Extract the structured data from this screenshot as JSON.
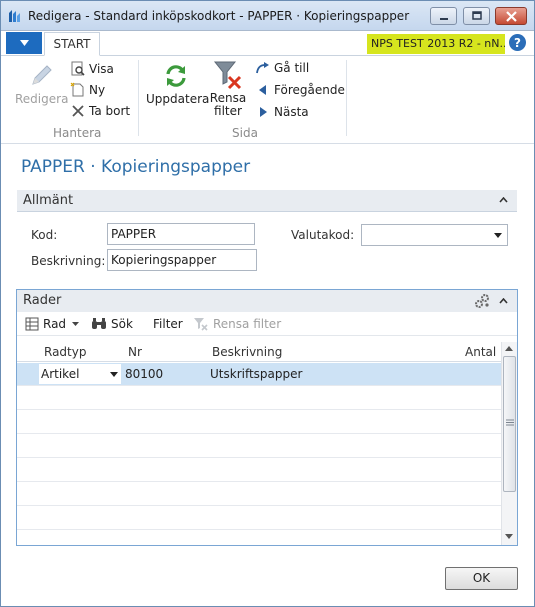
{
  "window": {
    "title": "Redigera - Standard inköpskodkort - PAPPER · Kopieringspapper"
  },
  "ribbon": {
    "tab_start": "START",
    "env_badge": "NPS TEST 2013 R2 - nN...",
    "help": "?",
    "hantera": {
      "group_label": "Hantera",
      "redigera": "Redigera",
      "visa": "Visa",
      "ny": "Ny",
      "ta_bort": "Ta bort"
    },
    "sida": {
      "group_label": "Sida",
      "uppdatera": "Uppdatera",
      "rensa_filter_1": "Rensa",
      "rensa_filter_2": "filter",
      "ga_till": "Gå till",
      "foregaende": "Föregående",
      "nasta": "Nästa"
    }
  },
  "page": {
    "title": "PAPPER · Kopieringspapper"
  },
  "general": {
    "heading": "Allmänt",
    "kod_label": "Kod:",
    "kod_value": "PAPPER",
    "beskrivning_label": "Beskrivning:",
    "beskrivning_value": "Kopieringspapper",
    "valutakod_label": "Valutakod:",
    "valutakod_value": ""
  },
  "lines": {
    "heading": "Rader",
    "toolbar": {
      "rad": "Rad",
      "sok": "Sök",
      "filter": "Filter",
      "rensa_filter": "Rensa filter"
    },
    "columns": {
      "radtyp": "Radtyp",
      "nr": "Nr",
      "beskrivning": "Beskrivning",
      "antal": "Antal"
    },
    "rows": [
      {
        "radtyp": "Artikel",
        "nr": "80100",
        "beskrivning": "Utskriftspapper",
        "antal": ""
      }
    ]
  },
  "footer": {
    "ok": "OK"
  },
  "colors": {
    "accent": "#1d6bbf",
    "title_blue": "#2f6fa8",
    "env_badge": "#d6e51e",
    "selected_row": "#cde2f5"
  }
}
